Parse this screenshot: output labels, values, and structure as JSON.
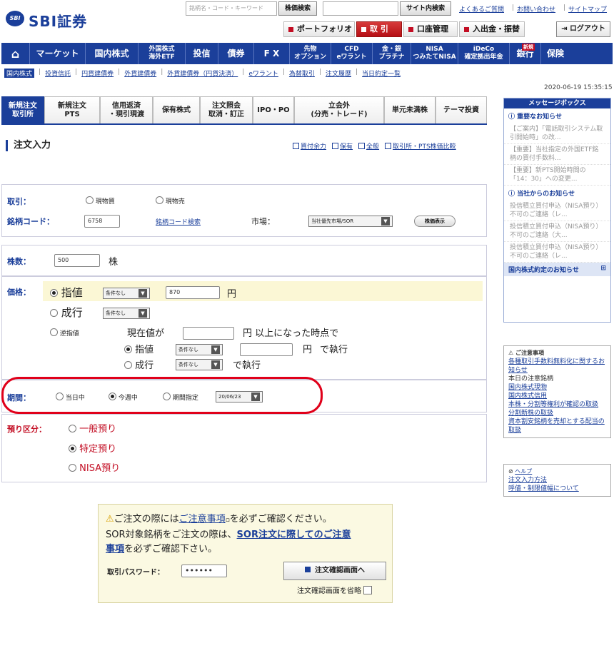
{
  "header": {
    "logo_badge": "SBI",
    "logo_text": "SBI証券",
    "search_placeholder": "銘柄名・コード・キーワード",
    "stock_search_btn": "株価検索",
    "site_search_btn": "サイト内検索",
    "faq_link": "よくあるご質問",
    "contact_link": "お問い合わせ",
    "sitemap_link": "サイトマップ",
    "top_buttons": [
      "ポートフォリオ",
      "取 引",
      "口座管理",
      "入出金・振替"
    ],
    "logout": "ログアウト"
  },
  "main_nav": [
    {
      "label": "⌂"
    },
    {
      "label": "マーケット"
    },
    {
      "label": "国内株式"
    },
    {
      "label": "外国株式\n海外ETF"
    },
    {
      "label": "投信"
    },
    {
      "label": "債券"
    },
    {
      "label": "F X"
    },
    {
      "label": "先物\nオプション"
    },
    {
      "label": "CFD\neワラント"
    },
    {
      "label": "金・銀\nプラチナ"
    },
    {
      "label": "NISA\nつみたてNISA"
    },
    {
      "label": "iDeCo\n確定拠出年金",
      "tag": "新規"
    },
    {
      "label": "銀行"
    },
    {
      "label": "保険"
    }
  ],
  "sub_nav": [
    "国内株式",
    "投資信託",
    "円貨建債券",
    "外貨建債券",
    "外貨建債券（円貨決済）",
    "eワラント",
    "為替取引",
    "注文履歴",
    "当日約定一覧"
  ],
  "datetime": "2020-06-19 15:35:15",
  "tabs": [
    "新規注文\n取引所",
    "新規注文\nPTS",
    "信用返済\n・現引現渡",
    "保有株式",
    "注文照会\n取消・訂正",
    "IPO・PO",
    "立会外\n(分売・トレード)",
    "単元未満株",
    "テーマ投資"
  ],
  "page_title": "注文入力",
  "title_links": [
    "買付余力",
    "保有",
    "全般",
    "取引所・PTS株価比較"
  ],
  "form": {
    "trade_label": "取引：",
    "trade_opt1": "現物買",
    "trade_opt2": "現物売",
    "code_label": "銘柄コード：",
    "code_value": "6758",
    "code_search_link": "銘柄コード検索",
    "market_label": "市場：",
    "market_value": "当社優先市場/SOR",
    "price_check_btn": "株価表示",
    "qty_label": "株数：",
    "qty_value": "500",
    "qty_unit": "株",
    "price_label": "価格：",
    "limit_label": "指値",
    "cond_none": "条件なし",
    "limit_value": "870",
    "yen": "円",
    "market_order_label": "成行",
    "stop_label": "逆指値",
    "stop_line1": "現在値が",
    "stop_line1b": "円 以上になった時点で",
    "stop_exec": "で執行",
    "period_label": "期間：",
    "period_opt1": "当日中",
    "period_opt2": "今週中",
    "period_opt3": "期間指定",
    "period_date": "20/06/23",
    "deposit_label": "預り区分：",
    "deposit_opt1": "一般預り",
    "deposit_opt2": "特定預り",
    "deposit_opt3": "NISA預り"
  },
  "message_box": {
    "header": "メッセージボックス",
    "important_title": "重要なお知らせ",
    "important_items": [
      "【ご案内】「電話取引システム取引開始時」の改...",
      "【重要】当社指定の外国ETF銘柄の買付手数料...",
      "【重要】新PTS開始時間の「14：30」への変更..."
    ],
    "notice_title": "当社からのお知らせ",
    "notice_items": [
      "投信積立買付申込（NISA預り）不可のご連絡（レ...",
      "投信積立買付申込（NISA預り）不可のご連絡（大...",
      "投信積立買付申込（NISA預り）不可のご連絡（レ..."
    ],
    "footer": "国内株式約定のお知らせ"
  },
  "notes_box": {
    "title": "ご注意事項",
    "items": [
      {
        "text": "各種取引手数料無料化に関するお知らせ",
        "link": true
      },
      {
        "text": "本日の注意銘柄",
        "link": false
      },
      {
        "text": "国内株式現物",
        "link": true
      },
      {
        "text": "国内株式信用",
        "link": true
      },
      {
        "text": "本株・分割等権利が確認の取扱",
        "link": true
      },
      {
        "text": "分割新株の取扱",
        "link": true
      },
      {
        "text": "資本割安銘柄を売却とする配当の取扱",
        "link": true
      }
    ]
  },
  "help_box": {
    "title": "ヘルプ",
    "items": [
      "注文入力方法",
      "呼値・制限値幅について"
    ]
  },
  "confirm": {
    "line1_a": "ご注文の際には",
    "line1_link": "ご注意事項",
    "line1_b": "を必ずご確認ください。",
    "line2_a": "SOR対象銘柄をご注文の際は、",
    "line2_link": "SOR注文に際してのご注意",
    "line3_link": "事項",
    "line3_b": "を必ずご確認下さい。",
    "pw_label": "取引パスワード：",
    "pw_value": "••••••",
    "order_btn": "注文確認画面へ",
    "skip_label": "注文確認画面を省略"
  },
  "colors": {
    "brand": "#1b3f9a",
    "accent_red": "#c30d23",
    "highlight": "#fbf7d5"
  }
}
